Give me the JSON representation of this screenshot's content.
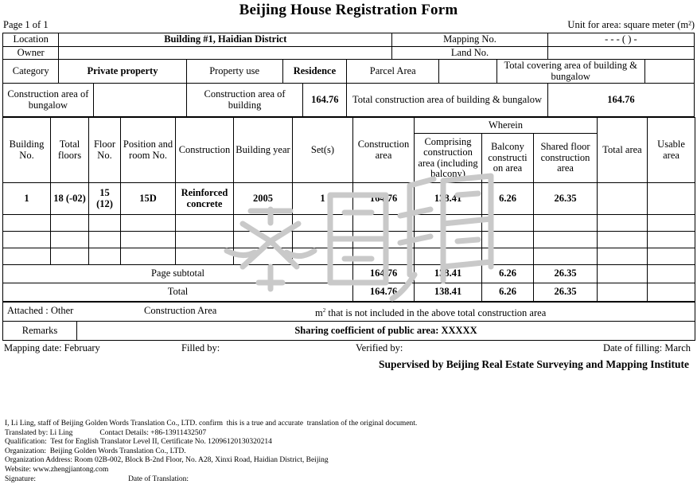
{
  "header": {
    "title": "Beijing House Registration Form",
    "page_label": "Page 1 of 1",
    "unit_label": "Unit for area: square meter (m²)"
  },
  "info_rows": {
    "location_label": "Location",
    "location_value": "Building #1,   Haidian District",
    "mapping_no_label": "Mapping No.",
    "mapping_no_value": "- - - ( ) -",
    "owner_label": "Owner",
    "owner_value": "",
    "land_no_label": "Land No.",
    "land_no_value": "",
    "category_label": "Category",
    "category_value": "Private property",
    "property_use_label": "Property use",
    "property_use_value": "Residence",
    "parcel_area_label": "Parcel Area",
    "parcel_area_value": "",
    "total_covering_label": "Total covering area of building & bungalow",
    "total_covering_value": "",
    "bungalow_area_label": "Construction area of bungalow",
    "bungalow_area_value": "",
    "building_area_label": "Construction area of building",
    "building_area_value": "164.76",
    "total_construction_label": "Total construction area of building & bungalow",
    "total_construction_value": "164.76"
  },
  "table": {
    "columns": [
      "Building No.",
      "Total floors",
      "Floor No.",
      "Position and room No.",
      "Construction",
      "Building year",
      "Set(s)",
      "Construction area",
      "Comprising construction area (including balcony)",
      "Balcony constructi on area",
      "Shared floor construction area",
      "Total area",
      "Usable area"
    ],
    "group_header": "Wherein",
    "rows": [
      {
        "building_no": "1",
        "total_floors": "18 (-02)",
        "floor_no_main": "15",
        "floor_no_sub": "(12)",
        "position_room_no": "15D",
        "construction": "Reinforced concrete",
        "building_year": "2005",
        "sets": "1",
        "construction_area": "164.76",
        "comprising_area": "138.41",
        "balcony_area": "6.26",
        "shared_floor_area": "26.35",
        "total_area": "",
        "usable_area": ""
      }
    ],
    "empty_row_count": 3,
    "subtotal": {
      "label": "Page subtotal",
      "construction_area": "164.76",
      "comprising_area": "138.41",
      "balcony_area": "6.26",
      "shared_floor_area": "26.35",
      "total_area": "",
      "usable_area": ""
    },
    "total": {
      "label": "Total",
      "construction_area": "164.76",
      "comprising_area": "138.41",
      "balcony_area": "6.26",
      "shared_floor_area": "26.35",
      "total_area": "",
      "usable_area": ""
    }
  },
  "attached": {
    "label": "Attached : Other",
    "construction_area_label": "Construction Area",
    "note": "m² that is not included in the above total construction area"
  },
  "remarks": {
    "label": "Remarks",
    "value": "Sharing coefficient of public area: XXXXX"
  },
  "signature_line": {
    "mapping_date": "Mapping date: February",
    "filled_by": "Filled by:",
    "verified_by": "Verified by:",
    "date_of_filling": "Date  of  filling: March",
    "supervised_by": "Supervised by Beijing Real Estate Surveying and Mapping Institute"
  },
  "translator": {
    "line1": "I, Li Ling, staff of Beijing Golden Words Translation Co., LTD. confirm  this is a true and accurate  translation of the original document.",
    "translated_by": "Translated by: Li Ling",
    "contact_details": "Contact Details: +86-13911432507",
    "qualification": "Qualification:  Test for English Translator Level II, Certificate No. 12096120130320214",
    "organization": "Organization:  Beijing Golden Words Translation Co., LTD.",
    "organization_address": "Organization Address: Room 02B-002, Block B-2nd Floor, No. A28, Xinxi Road, Haidian District, Beijing",
    "website": "Website: www.zhengjiantong.com",
    "signature": "Signature:",
    "date_of_translation": "Date of Translation:"
  },
  "watermark": {
    "name": "chinese-calligraphy-watermark",
    "color": "#c9c9c9"
  }
}
